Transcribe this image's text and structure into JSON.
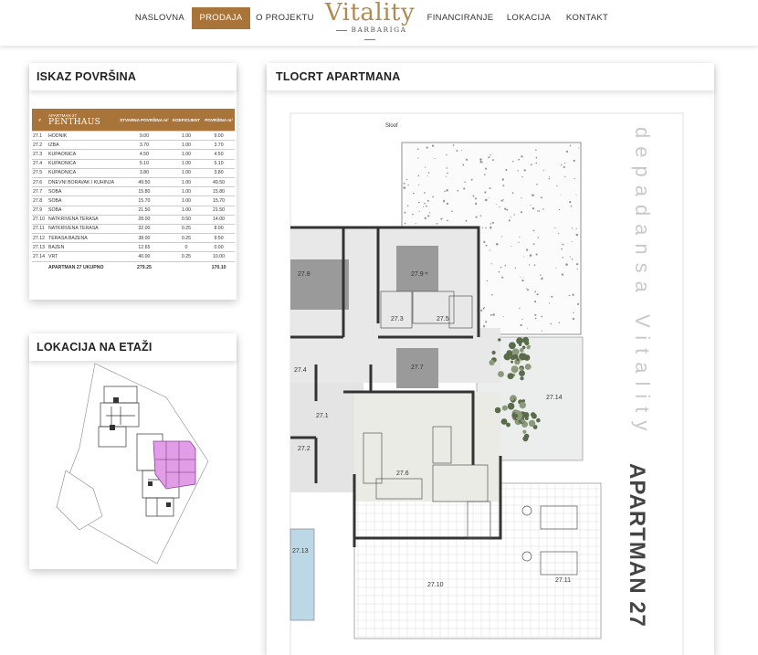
{
  "nav": {
    "items": [
      {
        "label": "NASLOVNA",
        "active": false
      },
      {
        "label": "PRODAJA",
        "active": true
      },
      {
        "label": "O PROJEKTU",
        "active": false
      },
      {
        "label": "FINANCIRANJE",
        "active": false
      },
      {
        "label": "LOKACIJA",
        "active": false
      },
      {
        "label": "KONTAKT",
        "active": false
      }
    ],
    "logo_main": "Vitality",
    "logo_sub": "BARBARIGA"
  },
  "colors": {
    "accent": "#a8743a",
    "logo": "#b08a4e"
  },
  "area_panel": {
    "title": "ISKAZ POVRŠINA",
    "header": {
      "hash": "#",
      "apartment": "APARTMAN 27",
      "type": "PENTHAUS",
      "col_real": "STVARNA POVRŠINA m²",
      "col_coef": "KOEFICIJENT",
      "col_area": "POVRŠINA m²"
    },
    "rows": [
      {
        "no": "27.1",
        "name": "HODNIK",
        "real": "9.00",
        "coef": "1.00",
        "area": "9.00"
      },
      {
        "no": "27.2",
        "name": "IZBA",
        "real": "3.70",
        "coef": "1.00",
        "area": "3.70"
      },
      {
        "no": "27.3",
        "name": "KUPAONICA",
        "real": "4.50",
        "coef": "1.00",
        "area": "4.50"
      },
      {
        "no": "27.4",
        "name": "KUPAONICA",
        "real": "5.10",
        "coef": "1.00",
        "area": "5.10"
      },
      {
        "no": "27.5",
        "name": "KUPAONICA",
        "real": "3.80",
        "coef": "1.00",
        "area": "3.80"
      },
      {
        "no": "27.6",
        "name": "DNEVNI BORAVAK I KUHINJA",
        "real": "49.50",
        "coef": "1.00",
        "area": "49.50"
      },
      {
        "no": "27.7",
        "name": "SOBA",
        "real": "15.80",
        "coef": "1.00",
        "area": "15.80"
      },
      {
        "no": "27.8",
        "name": "SOBA",
        "real": "15.70",
        "coef": "1.00",
        "area": "15.70"
      },
      {
        "no": "27.9",
        "name": "SOBA",
        "real": "21.50",
        "coef": "1.00",
        "area": "21.50"
      },
      {
        "no": "27.10",
        "name": "NATKRIVENA TERASA",
        "real": "28.00",
        "coef": "0.50",
        "area": "14.00"
      },
      {
        "no": "27.11",
        "name": "NATKRIVENA TERASA",
        "real": "32.00",
        "coef": "0.25",
        "area": "8.00"
      },
      {
        "no": "27.12",
        "name": "TERASA BAZENA",
        "real": "38.00",
        "coef": "0.25",
        "area": "9.50"
      },
      {
        "no": "27.13",
        "name": "BAZEN",
        "real": "12.65",
        "coef": "0",
        "area": "0.00"
      },
      {
        "no": "27.14",
        "name": "VRT",
        "real": "40.00",
        "coef": "0.25",
        "area": "10.00"
      }
    ],
    "total": {
      "name": "APARTMAN 27 UKUPNO",
      "real": "279.25",
      "area": "170.10"
    }
  },
  "location_panel": {
    "title": "LOKACIJA NA ETAŽI"
  },
  "plan_panel": {
    "title": "TLOCRT APARTMANA",
    "side_text_light": "depadansa Vitality",
    "side_text_dark": "APARTMAN 27",
    "labels": {
      "r1": "27.1",
      "r2": "27.2",
      "r3": "27.3",
      "r4": "27.4",
      "r5": "27.5",
      "r6": "27.6",
      "r7": "27.7",
      "r8": "27.8",
      "r9": "27.9",
      "r10": "27.10",
      "r11": "27.11",
      "r13": "27.13",
      "r14": "27.14",
      "roof": "Sloof"
    }
  }
}
